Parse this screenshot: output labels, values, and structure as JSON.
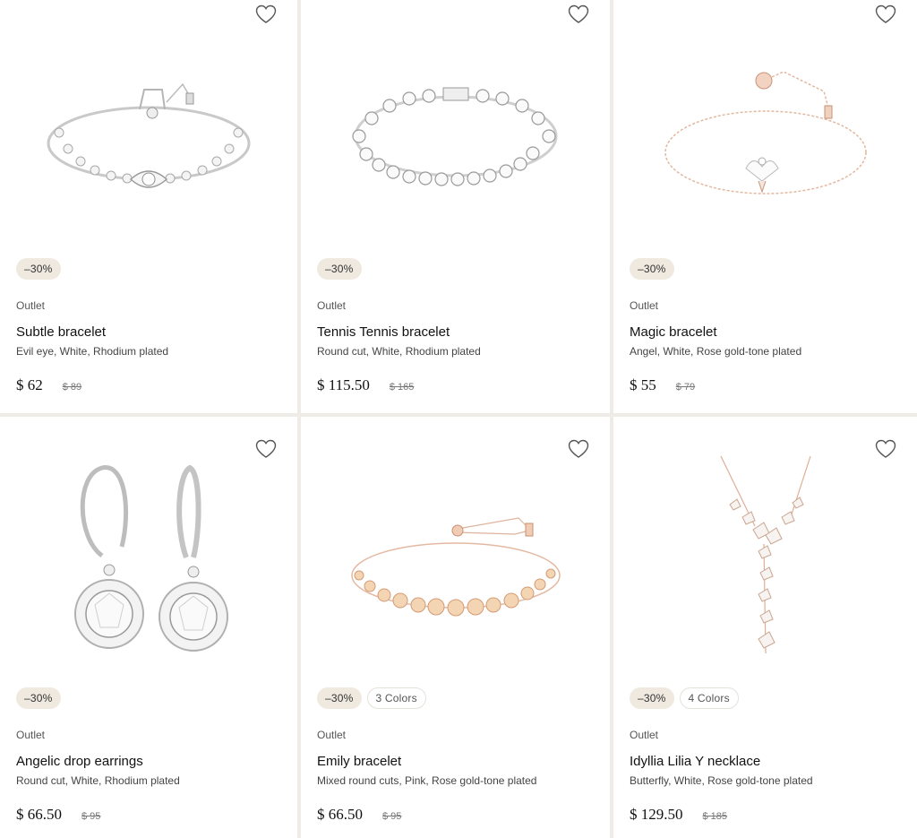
{
  "products": [
    {
      "discount": "–30%",
      "colors": "",
      "tag": "Outlet",
      "name": "Subtle bracelet",
      "details": "Evil eye, White, Rhodium plated",
      "price": "$ 62",
      "old_price": "$ 89",
      "image": "bracelet-silver-evil-eye"
    },
    {
      "discount": "–30%",
      "colors": "",
      "tag": "Outlet",
      "name": "Tennis Tennis bracelet",
      "details": "Round cut, White, Rhodium plated",
      "price": "$ 115.50",
      "old_price": "$ 165",
      "image": "bracelet-silver-tennis"
    },
    {
      "discount": "–30%",
      "colors": "",
      "tag": "Outlet",
      "name": "Magic bracelet",
      "details": "Angel, White, Rose gold-tone plated",
      "price": "$ 55",
      "old_price": "$ 79",
      "image": "bracelet-rose-angel"
    },
    {
      "discount": "–30%",
      "colors": "",
      "tag": "Outlet",
      "name": "Angelic drop earrings",
      "details": "Round cut, White, Rhodium plated",
      "price": "$ 66.50",
      "old_price": "$ 95",
      "image": "earrings-silver-drop"
    },
    {
      "discount": "–30%",
      "colors": "3 Colors",
      "tag": "Outlet",
      "name": "Emily bracelet",
      "details": "Mixed round cuts, Pink, Rose gold-tone plated",
      "price": "$ 66.50",
      "old_price": "$ 95",
      "image": "bracelet-rose-pink-stones"
    },
    {
      "discount": "–30%",
      "colors": "4 Colors",
      "tag": "Outlet",
      "name": "Idyllia Lilia Y necklace",
      "details": "Butterfly, White, Rose gold-tone plated",
      "price": "$ 129.50",
      "old_price": "$ 185",
      "image": "necklace-rose-butterfly"
    }
  ],
  "icons": {
    "favorite": "heart-outline-icon"
  },
  "colors": {
    "badge_bg": "#efe9df",
    "page_bg": "#efebe6",
    "card_bg": "#ffffff"
  }
}
